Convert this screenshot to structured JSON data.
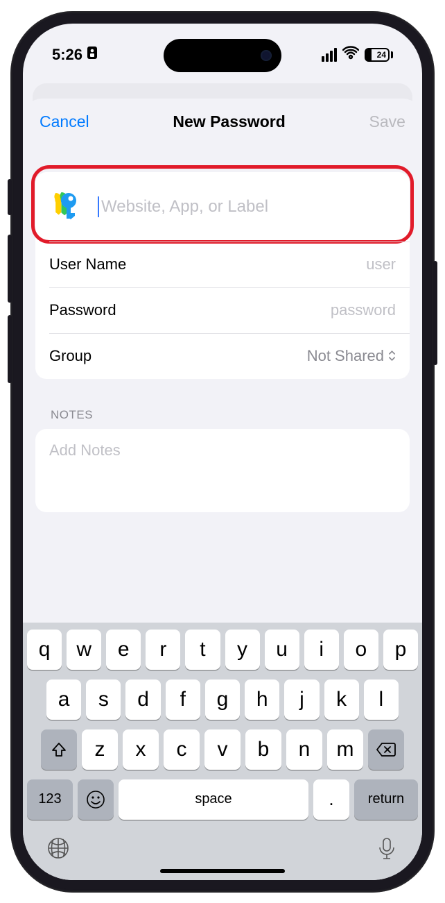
{
  "status": {
    "time": "5:26",
    "battery_pct": "24"
  },
  "nav": {
    "cancel": "Cancel",
    "title": "New Password",
    "save": "Save"
  },
  "form": {
    "website_placeholder": "Website, App, or Label",
    "username_label": "User Name",
    "username_placeholder": "user",
    "password_label": "Password",
    "password_placeholder": "password",
    "group_label": "Group",
    "group_value": "Not Shared"
  },
  "notes": {
    "header": "NOTES",
    "placeholder": "Add Notes"
  },
  "keyboard": {
    "row1": [
      "q",
      "w",
      "e",
      "r",
      "t",
      "y",
      "u",
      "i",
      "o",
      "p"
    ],
    "row2": [
      "a",
      "s",
      "d",
      "f",
      "g",
      "h",
      "j",
      "k",
      "l"
    ],
    "row3": [
      "z",
      "x",
      "c",
      "v",
      "b",
      "n",
      "m"
    ],
    "switch": "123",
    "space": "space",
    "dot": ".",
    "ret": "return"
  }
}
